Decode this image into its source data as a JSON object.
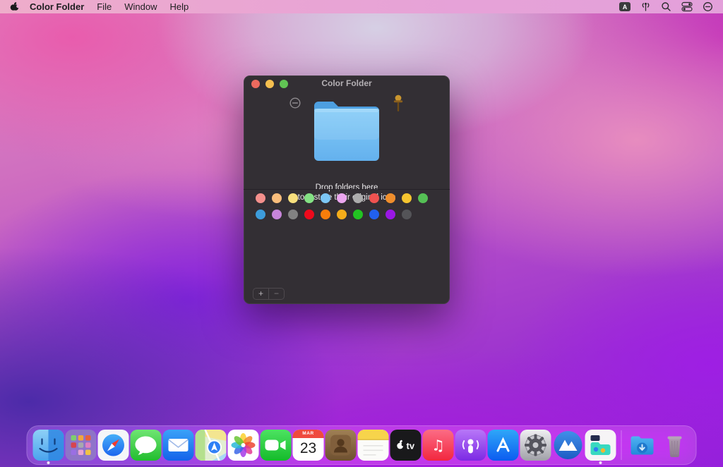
{
  "menu_bar": {
    "app_name": "Color Folder",
    "menus": [
      "File",
      "Window",
      "Help"
    ],
    "input_source_label": "A"
  },
  "window": {
    "title": "Color Folder",
    "drop_line1": "Drop folders here",
    "drop_line2": "to restore their original icon",
    "add_label": "+",
    "remove_label": "−",
    "palette_row1": [
      "#F4908C",
      "#F9BD7B",
      "#F8DF7D",
      "#84E184",
      "#7CC7F5",
      "#EBA6EF",
      "#ACACAC",
      "#EF5250",
      "#F08E2C",
      "#F6C52F",
      "#55C055"
    ],
    "palette_row2": [
      "#3D9CDB",
      "#C785DA",
      "#828282",
      "#EE0A1C",
      "#F87D0B",
      "#F4AC1A",
      "#22C322",
      "#2160EF",
      "#9A17E4",
      "#545458"
    ]
  },
  "dock": {
    "items": [
      {
        "id": "finder",
        "icon": "finder-icon",
        "running": true
      },
      {
        "id": "launchpad",
        "icon": "launchpad-icon",
        "running": false
      },
      {
        "id": "safari",
        "icon": "safari-icon",
        "running": false
      },
      {
        "id": "messages",
        "icon": "messages-icon",
        "running": false
      },
      {
        "id": "mail",
        "icon": "mail-icon",
        "running": false
      },
      {
        "id": "maps",
        "icon": "maps-icon",
        "running": false
      },
      {
        "id": "photos",
        "icon": "photos-icon",
        "running": false
      },
      {
        "id": "facetime",
        "icon": "facetime-icon",
        "running": false
      },
      {
        "id": "calendar",
        "icon": "calendar-icon",
        "running": false,
        "month": "MAR",
        "day": "23"
      },
      {
        "id": "contacts",
        "icon": "contacts-icon",
        "running": false
      },
      {
        "id": "notes",
        "icon": "notes-icon",
        "running": false
      },
      {
        "id": "tv",
        "icon": "apple-tv-icon",
        "running": false,
        "label_text": "tv"
      },
      {
        "id": "music",
        "icon": "music-icon",
        "running": false
      },
      {
        "id": "podcasts",
        "icon": "podcasts-icon",
        "running": false
      },
      {
        "id": "appstore",
        "icon": "app-store-icon",
        "running": false
      },
      {
        "id": "sysprefs",
        "icon": "system-preferences-icon",
        "running": false
      },
      {
        "id": "mountain",
        "icon": "mountain-app-icon",
        "running": false
      },
      {
        "id": "colorfolder",
        "icon": "color-folder-app-icon",
        "running": true
      },
      {
        "id": "separator",
        "icon": "dock-separator",
        "running": false
      },
      {
        "id": "downloads",
        "icon": "downloads-folder-icon",
        "running": false
      },
      {
        "id": "trash",
        "icon": "trash-icon",
        "running": false
      }
    ]
  },
  "colors": {
    "traffic_close": "#ec6a5e",
    "traffic_min": "#f5bf4f",
    "traffic_zoom": "#61c454",
    "window_bg": "#332f34",
    "folder_blue": "#74c3f2",
    "menu_bar_pink": "#e7a5d6"
  }
}
